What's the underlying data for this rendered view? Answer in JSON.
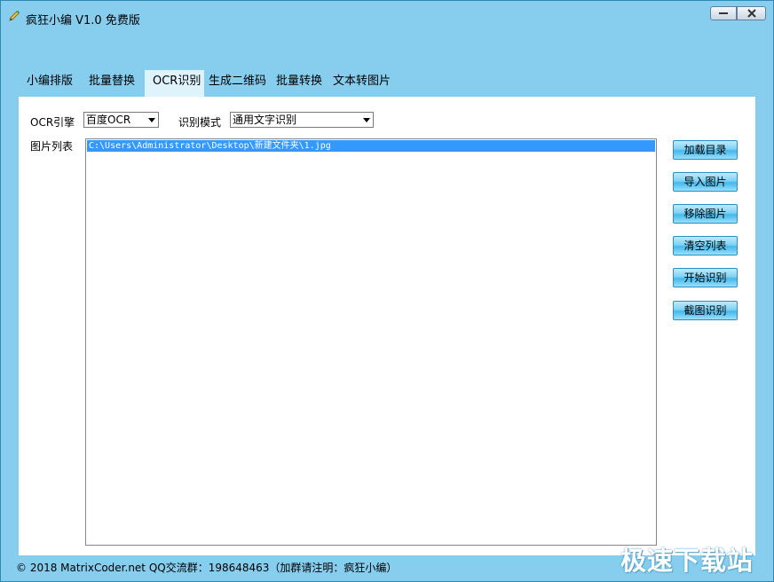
{
  "window": {
    "title": "疯狂小编 V1.0  免费版",
    "minimize_icon": "minimize-icon",
    "close_icon": "close-icon"
  },
  "tabs": [
    {
      "label": "小编排版"
    },
    {
      "label": "批量替换"
    },
    {
      "label": "OCR识别",
      "active": true
    },
    {
      "label": "生成二维码"
    },
    {
      "label": "批量转换"
    },
    {
      "label": "文本转图片"
    }
  ],
  "ocr": {
    "engine_label": "OCR引擎",
    "engine_value": "百度OCR",
    "mode_label": "识别模式",
    "mode_value": "通用文字识别",
    "list_label": "图片列表",
    "list_items": [
      "C:\\Users\\Administrator\\Desktop\\新建文件夹\\1.jpg"
    ]
  },
  "buttons": {
    "load_dir": "加载目录",
    "import_image": "导入图片",
    "remove_image": "移除图片",
    "clear_list": "清空列表",
    "start_ocr": "开始识别",
    "screenshot_ocr": "截图识别"
  },
  "status": {
    "text": "© 2018 MatrixCoder.net    QQ交流群：198648463（加群请注明：疯狂小编）"
  },
  "watermark": "极速下载站",
  "colors": {
    "window_bg": "#86cdee",
    "active_tab": "#dff3fc",
    "selection": "#3399ff"
  }
}
